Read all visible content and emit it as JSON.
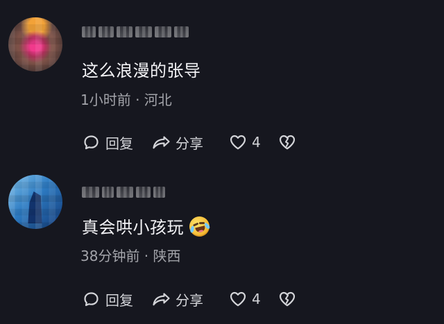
{
  "comments": [
    {
      "text": "这么浪漫的张导",
      "meta": "1小时前 · 河北",
      "actions": {
        "reply_label": "回复",
        "share_label": "分享",
        "like_count": "4"
      },
      "avatar": "pink-flower-avatar"
    },
    {
      "text": "真会哄小孩玩",
      "meta": "38分钟前 · 陕西",
      "emoji": "laughing-tears-emoji",
      "actions": {
        "reply_label": "回复",
        "share_label": "分享",
        "like_count": "4"
      },
      "avatar": "blue-abstract-avatar"
    }
  ],
  "theme": {
    "background": "#16171f",
    "primary_text": "#f3f3f6",
    "secondary_text": "#a3a4aa",
    "action_text": "#d3d4d8"
  },
  "icons": {
    "reply": "reply-bubble-icon",
    "share": "share-arrow-icon",
    "like": "heart-outline-icon",
    "dislike": "broken-heart-icon"
  }
}
